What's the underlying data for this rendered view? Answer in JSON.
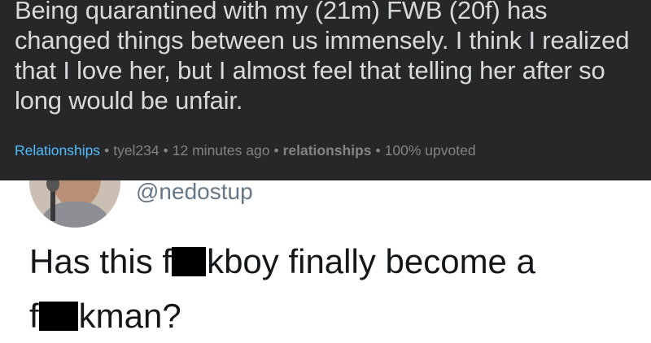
{
  "post": {
    "title": "Being quarantined with my (21m) FWB (20f) has changed things between us immensely. I think I realized that I love her, but I almost feel that telling her after so long would be unfair.",
    "meta": {
      "subreddit": "Relationships",
      "author": "tyel234",
      "time": "12 minutes ago",
      "flair": "relationships",
      "upvote_ratio": "100% upvoted",
      "separator": "•"
    }
  },
  "tweet": {
    "handle": "@nedostup",
    "text_part1": "Has this f",
    "text_part2": "kboy finally become a",
    "text_part3": "f",
    "text_part4": "kman?"
  },
  "colors": {
    "card_background": "#272729",
    "title": "#d7dadc",
    "subreddit_link": "#4fbcff",
    "meta": "#818384",
    "handle": "#657786",
    "tweet_text": "#14171a",
    "redaction": "#000000"
  }
}
